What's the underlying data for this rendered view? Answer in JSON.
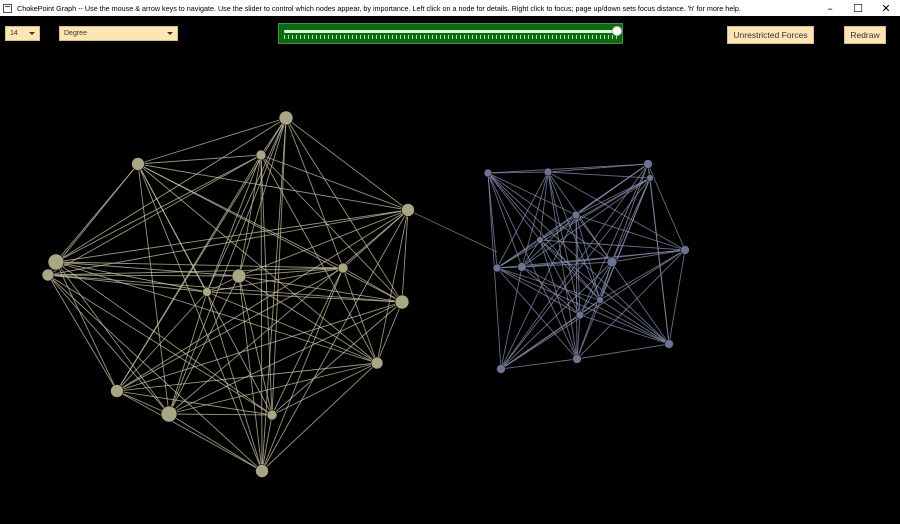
{
  "window": {
    "title": "ChokePoint Graph -- Use the mouse & arrow keys to navigate. Use the slider to control which nodes appear, by importance. Left click on a node for details. Right click to focus; page up/down sets focus distance. 'h' for more help.",
    "minimize": "–",
    "maximize": "☐",
    "close": "✕"
  },
  "controls": {
    "count_dropdown": "14",
    "metric_dropdown": "Degree",
    "slider_value": 1.0,
    "forces_button": "Unrestricted Forces",
    "redraw_button": "Redraw"
  },
  "graph": {
    "colors": {
      "cluster_a": "#c9c7a0",
      "cluster_b": "#8a90b0",
      "bridge": "#7a7a6a"
    },
    "cluster_a_node_count": 15,
    "cluster_b_node_count": 15,
    "bridge_edges": 1
  }
}
